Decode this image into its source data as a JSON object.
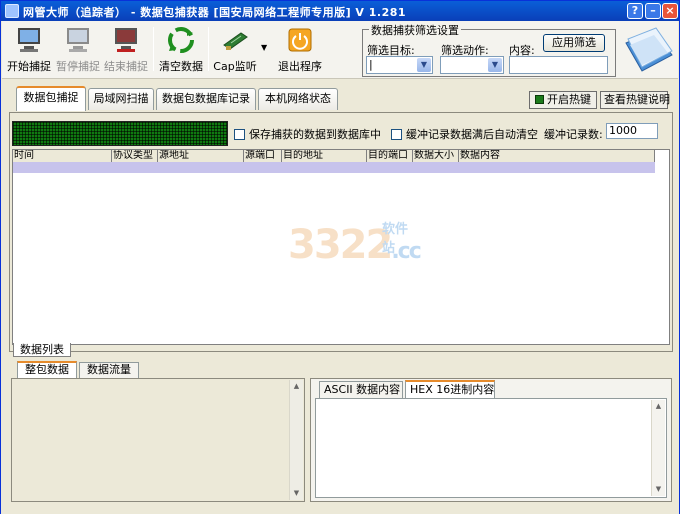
{
  "window": {
    "title": "网管大师（追踪者） - 数据包捕获器 [国安局网络工程师专用版] V 1.281",
    "help_label": "?",
    "minimize_label": "–",
    "close_label": "×"
  },
  "toolbar": {
    "start_label": "开始捕捉",
    "pause_label": "暂停捕捉",
    "stop_label": "结束捕捉",
    "clear_label": "清空数据",
    "cap_label": "Cap监听",
    "exit_label": "退出程序",
    "dropdown_arrow": "▼"
  },
  "filter": {
    "group_title": "数据捕获筛选设置",
    "target_label": "筛选目标:",
    "action_label": "筛选动作:",
    "content_label": "内容:",
    "apply_label": "应用筛选",
    "target_value": "|",
    "action_value": "",
    "content_value": ""
  },
  "tabs": {
    "items": [
      {
        "label": "数据包捕捉"
      },
      {
        "label": "局域网扫描"
      },
      {
        "label": "数据包数据库记录"
      },
      {
        "label": "本机网络状态"
      }
    ],
    "hotkey_start": "开启热键",
    "hotkey_help": "查看热键说明"
  },
  "capture": {
    "save_to_db": "保存捕获的数据到数据库中",
    "auto_clear": "缓冲记录数据满后自动清空",
    "buffer_label": "缓冲记录数:",
    "buffer_value": "1000",
    "columns": [
      "时间",
      "协议类型",
      "源地址",
      "源端口",
      "目的地址",
      "目的端口",
      "数据大小",
      "数据内容"
    ],
    "list_tab": "数据列表"
  },
  "watermark": {
    "main": "3322",
    "domain": ".cc",
    "sub": "软件站"
  },
  "bottom": {
    "left_tabs": [
      "整包数据",
      "数据流量"
    ],
    "right_tabs": [
      "ASCII 数据内容",
      "HEX 16进制内容"
    ],
    "scroll_up": "▲",
    "scroll_down": "▼"
  },
  "colors": {
    "titlebar": "#0a4fc8",
    "led_green": "#0f7a10",
    "selected_row": "#c7c3ec",
    "tab_accent": "#e68b2c"
  }
}
